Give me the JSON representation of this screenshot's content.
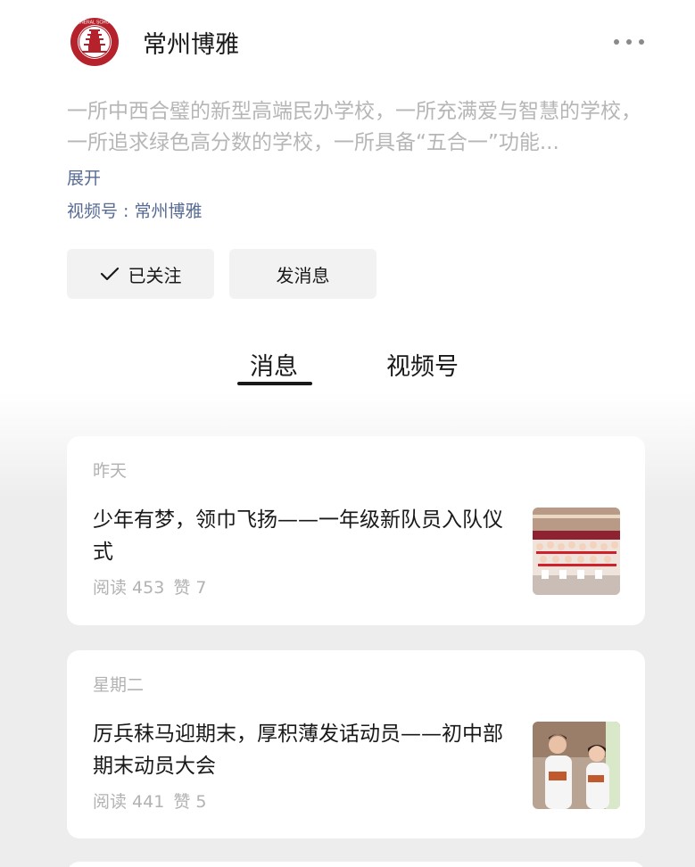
{
  "header": {
    "account_name": "常州博雅",
    "logo_text": "GENERAL SCHOOL"
  },
  "profile": {
    "description": "一所中西合璧的新型高端民办学校，一所充满爱与智慧的学校，一所追求绿色高分数的学校，一所具备“五合一”功能...",
    "expand_label": "展开",
    "channel_label": "视频号 : 常州博雅"
  },
  "actions": {
    "follow_label": "已关注",
    "message_label": "发消息"
  },
  "tabs": [
    {
      "label": "消息",
      "active": true
    },
    {
      "label": "视频号",
      "active": false
    }
  ],
  "articles": [
    {
      "date": "昨天",
      "title": "少年有梦，领巾飞扬——一年级新队员入队仪式",
      "reads": "阅读 453",
      "likes": "赞 7",
      "thumb": "group-photo-students"
    },
    {
      "date": "星期二",
      "title": "厉兵秣马迎期末，厚积薄发话动员——初中部期末动员大会",
      "reads": "阅读 441",
      "likes": "赞 5",
      "thumb": "students-speaking-photo"
    }
  ],
  "colors": {
    "link": "#576b95",
    "muted": "#b2b2b2",
    "logo_red": "#b5222b"
  }
}
